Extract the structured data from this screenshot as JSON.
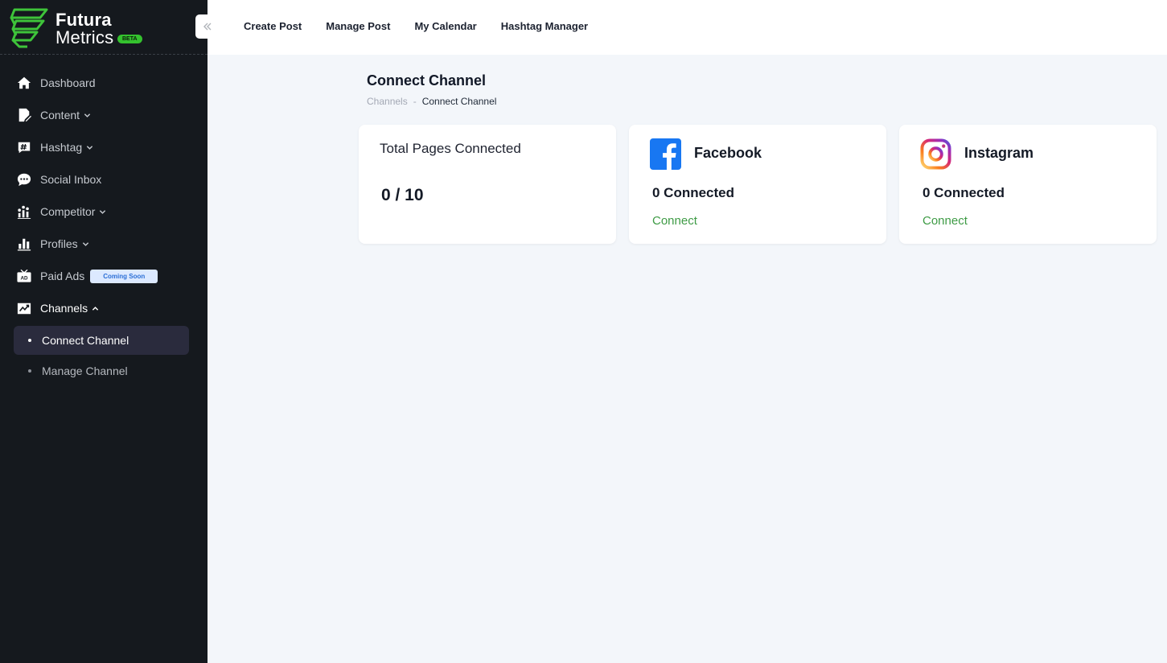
{
  "brand": {
    "line1": "Futura",
    "line2": "Metrics",
    "badge": "BETA"
  },
  "sidebar": {
    "items": [
      {
        "label": "Dashboard",
        "icon": "home-icon"
      },
      {
        "label": "Content",
        "icon": "content-icon"
      },
      {
        "label": "Hashtag",
        "icon": "hashtag-icon"
      },
      {
        "label": "Social Inbox",
        "icon": "chat-icon"
      },
      {
        "label": "Competitor",
        "icon": "competitor-icon"
      },
      {
        "label": "Profiles",
        "icon": "bar-chart-icon"
      },
      {
        "label": "Paid Ads",
        "icon": "ad-icon",
        "badge": "Coming Soon"
      },
      {
        "label": "Channels",
        "icon": "channels-icon"
      }
    ],
    "sub_items": [
      {
        "label": "Connect Channel",
        "active": true
      },
      {
        "label": "Manage Channel",
        "active": false
      }
    ]
  },
  "topnav": {
    "items": [
      "Create Post",
      "Manage Post",
      "My Calendar",
      "Hashtag Manager"
    ]
  },
  "page": {
    "title": "Connect Channel",
    "breadcrumb": {
      "parent": "Channels",
      "separator": "-",
      "current": "Connect Channel"
    }
  },
  "cards": {
    "total": {
      "title": "Total Pages Connected",
      "value": "0 / 10"
    },
    "facebook": {
      "name": "Facebook",
      "count": "0 Connected",
      "action": "Connect",
      "color": "#1877f2"
    },
    "instagram": {
      "name": "Instagram",
      "count": "0 Connected",
      "action": "Connect"
    }
  },
  "colors": {
    "sidebar_bg": "#15191e",
    "accent_green": "#3e9b45",
    "active_bg": "#2a2b3d",
    "badge_blue": "#2b6fd6"
  }
}
